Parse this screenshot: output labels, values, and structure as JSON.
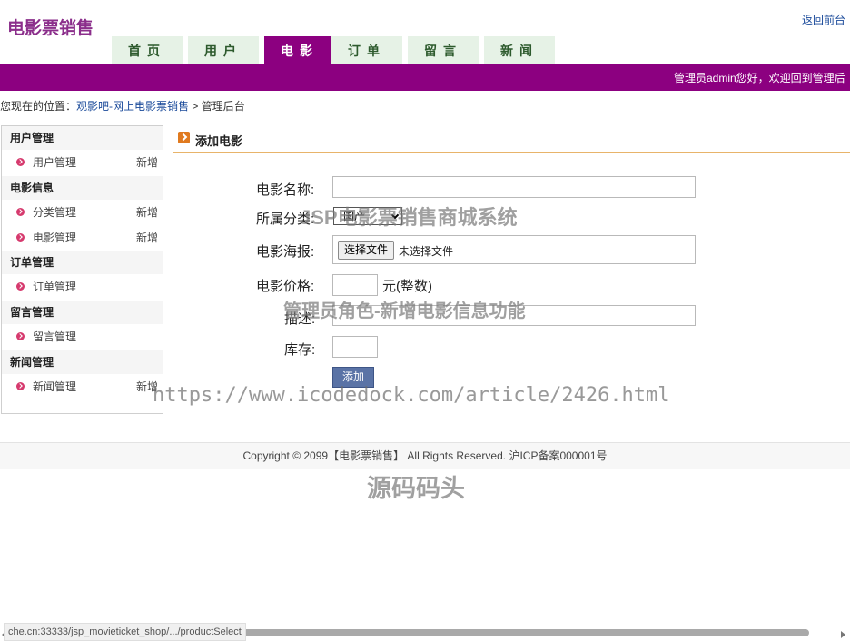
{
  "header": {
    "logo": "电影票销售",
    "back_link": "返回前台"
  },
  "nav": {
    "tabs": [
      {
        "label": "首页",
        "active": false
      },
      {
        "label": "用户",
        "active": false
      },
      {
        "label": "电影",
        "active": true
      },
      {
        "label": "订单",
        "active": false
      },
      {
        "label": "留言",
        "active": false
      },
      {
        "label": "新闻",
        "active": false
      }
    ]
  },
  "topbar": {
    "welcome": "管理员admin您好，欢迎回到管理后"
  },
  "breadcrumb": {
    "prefix": "您现在的位置：",
    "site": "观影吧-网上电影票销售",
    "separator": " > ",
    "current": "管理后台"
  },
  "sidebar": {
    "groups": [
      {
        "title": "用户管理",
        "items": [
          {
            "label": "用户管理",
            "add": "新增"
          }
        ]
      },
      {
        "title": "电影信息",
        "items": [
          {
            "label": "分类管理",
            "add": "新增"
          },
          {
            "label": "电影管理",
            "add": "新增"
          }
        ]
      },
      {
        "title": "订单管理",
        "items": [
          {
            "label": "订单管理",
            "add": ""
          }
        ]
      },
      {
        "title": "留言管理",
        "items": [
          {
            "label": "留言管理",
            "add": ""
          }
        ]
      },
      {
        "title": "新闻管理",
        "items": [
          {
            "label": "新闻管理",
            "add": "新增"
          }
        ]
      }
    ]
  },
  "panel": {
    "title": "添加电影"
  },
  "form": {
    "name_label": "电影名称:",
    "name_value": "",
    "category_label": "所属分类:",
    "category_value": "国产",
    "poster_label": "电影海报:",
    "poster_button": "选择文件",
    "poster_status": "未选择文件",
    "price_label": "电影价格:",
    "price_value": "",
    "price_unit": "元(整数)",
    "desc_label": "描述:",
    "desc_value": "",
    "stock_label": "库存:",
    "stock_value": "",
    "submit_label": "添加"
  },
  "watermarks": {
    "title": "JSP电影票销售商城系统",
    "subtitle": "管理员角色-新增电影信息功能",
    "url": "https://www.icodedock.com/article/2426.html",
    "brand": "源码码头"
  },
  "footer": {
    "copyright": "Copyright © 2099【电影票销售】 All Rights Reserved. 沪ICP备案000001号"
  },
  "statusbar": {
    "url": "che.cn:33333/jsp_movieticket_shop/.../productSelect"
  },
  "colors": {
    "brand_purple": "#8c0080",
    "logo_purple": "#8b2e8b",
    "tab_inactive": "#e6f2e6",
    "panel_line": "#e8b46a",
    "button_blue": "#5a73a6"
  }
}
